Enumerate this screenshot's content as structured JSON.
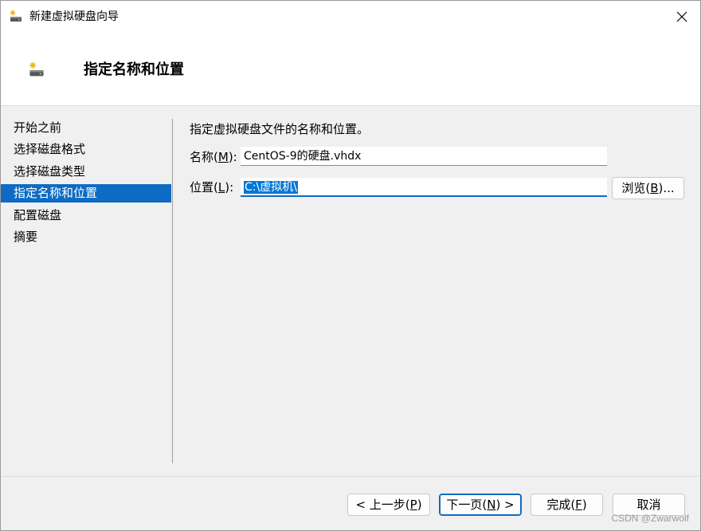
{
  "window": {
    "title": "新建虚拟硬盘向导",
    "close_glyph": "✕"
  },
  "header": {
    "title": "指定名称和位置"
  },
  "nav": {
    "items": [
      {
        "label": "开始之前",
        "selected": false
      },
      {
        "label": "选择磁盘格式",
        "selected": false
      },
      {
        "label": "选择磁盘类型",
        "selected": false
      },
      {
        "label": "指定名称和位置",
        "selected": true
      },
      {
        "label": "配置磁盘",
        "selected": false
      },
      {
        "label": "摘要",
        "selected": false
      }
    ]
  },
  "main": {
    "description": "指定虚拟硬盘文件的名称和位置。",
    "name_label_prefix": "名称(",
    "name_label_key": "M",
    "name_label_suffix": "):",
    "name_value": "CentOS-9的硬盘.vhdx",
    "location_label_prefix": "位置(",
    "location_label_key": "L",
    "location_label_suffix": "):",
    "location_value": "C:\\虚拟机\\",
    "browse_prefix": "浏览(",
    "browse_key": "B",
    "browse_suffix": ")..."
  },
  "footer": {
    "prev_prefix": "< 上一步(",
    "prev_key": "P",
    "prev_suffix": ")",
    "next_prefix": "下一页(",
    "next_key": "N",
    "next_suffix": ") >",
    "finish_prefix": "完成(",
    "finish_key": "F",
    "finish_suffix": ")",
    "cancel": "取消"
  },
  "watermark": "CSDN @Zwarwolf",
  "colors": {
    "accent": "#0e6bc4",
    "selection": "#0078d7"
  },
  "icons": {
    "app": "disk-wizard-icon",
    "close": "close-icon"
  }
}
